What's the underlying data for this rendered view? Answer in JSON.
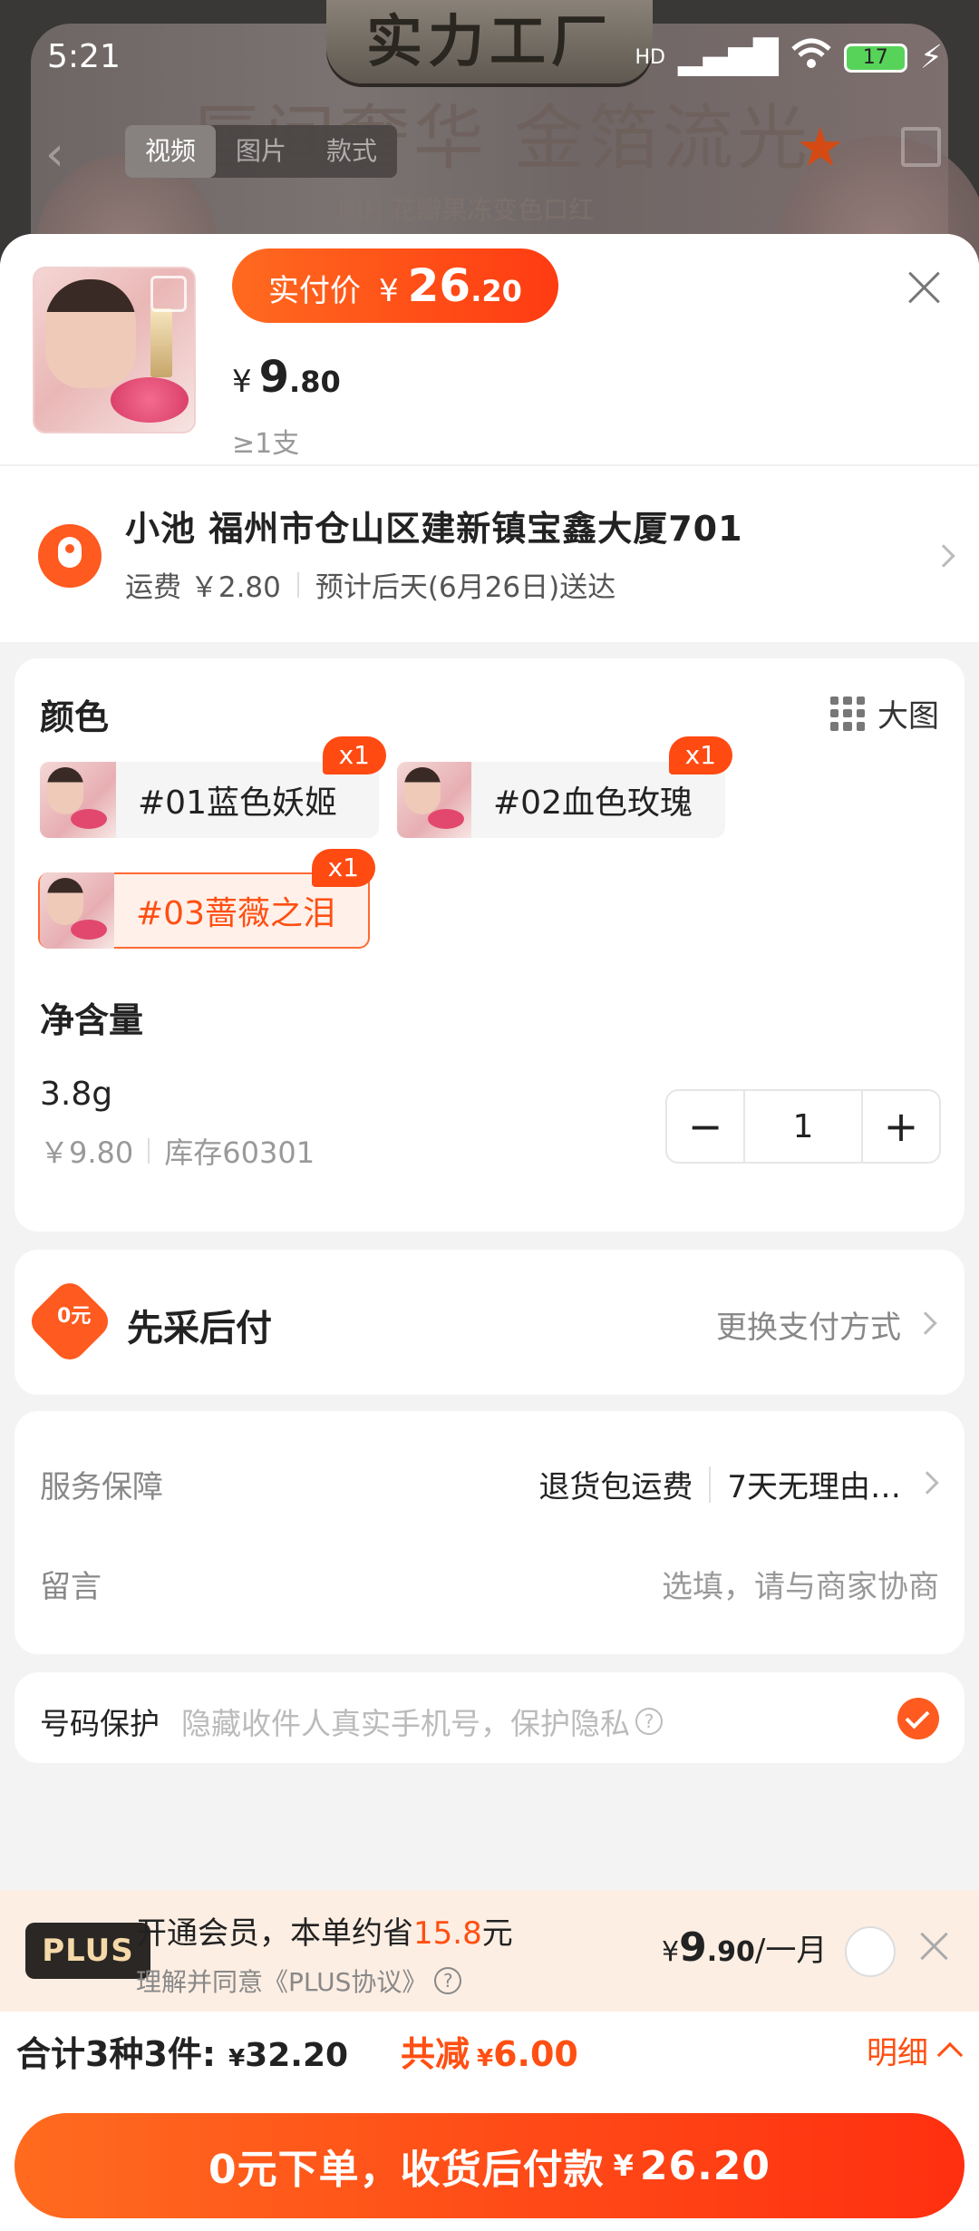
{
  "status_bar": {
    "time": "5:21",
    "signal": "HD",
    "battery": "17"
  },
  "background": {
    "plaque": "实力工厂",
    "headline": "唇间奢华 金箔流光",
    "subline": "HIH 花瓣果冻变色口红",
    "tabs": [
      "视频",
      "图片",
      "款式"
    ]
  },
  "header": {
    "paid_label": "实付价",
    "paid_currency": "¥",
    "paid_int": "26",
    "paid_dec": ".20",
    "unit_currency": "¥",
    "unit_int": "9",
    "unit_dec": ".80",
    "moq": "≥1支"
  },
  "address": {
    "line": "小池 福州市仓山区建新镇宝鑫大厦701",
    "shipping": "运费 ￥2.80",
    "eta": "预计后天(6月26日)送达"
  },
  "color_section": {
    "title": "颜色",
    "big_pic": "大图",
    "variants": [
      {
        "label": "#01蓝色妖姬",
        "badge": "x1",
        "selected": false
      },
      {
        "label": "#02血色玫瑰",
        "badge": "x1",
        "selected": false
      },
      {
        "label": "#03蔷薇之泪",
        "badge": "x1",
        "selected": true
      }
    ]
  },
  "net_section": {
    "title": "净含量",
    "value": "3.8g",
    "price": "￥9.80",
    "stock": "库存60301",
    "qty": "1",
    "minus": "−",
    "plus": "+"
  },
  "payment": {
    "title": "先采后付",
    "change": "更换支付方式",
    "icon_text": "0元"
  },
  "service": {
    "label": "服务保障",
    "tag1": "退货包运费",
    "tag2": "7天无理由…",
    "message_label": "留言",
    "message_placeholder": "选填，请与商家协商"
  },
  "privacy": {
    "label": "号码保护",
    "placeholder": "隐藏收件人真实手机号，保护隐私",
    "checked": true
  },
  "plus": {
    "logo": "PLUS",
    "text_pre": "开通会员，本单约省",
    "save_amount": "15.8",
    "text_post": "元",
    "agree": "理解并同意《PLUS协议》",
    "price_cur": "¥",
    "price_int": "9",
    "price_dec": ".90",
    "price_period": "/一月"
  },
  "totals": {
    "label": "合计3种3件:",
    "amount_cur": "¥",
    "amount": "32.20",
    "discount_label": "共减",
    "discount_cur": "¥",
    "discount": "6.00",
    "detail": "明细"
  },
  "submit": {
    "text": "0元下单，收货后付款",
    "cur": "¥",
    "amount": "26.20"
  },
  "colors": {
    "accent": "#ff4f12",
    "accent_grad_start": "#ff6b1f",
    "accent_grad_end": "#ff2f10",
    "plus_bg": "#fdeee3"
  }
}
